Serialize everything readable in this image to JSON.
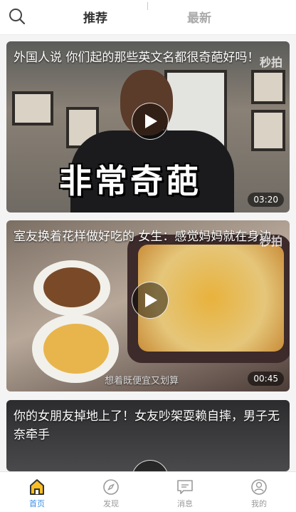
{
  "header": {
    "search_icon": "search-icon",
    "tabs": [
      {
        "label": "推荐",
        "active": true
      },
      {
        "label": "最新",
        "active": false
      }
    ]
  },
  "feed": [
    {
      "title": "外国人说 你们起的那些英文名都很奇葩好吗！",
      "duration": "03:20",
      "overlay_text": "非常奇葩",
      "watermark": "秒拍"
    },
    {
      "title": "室友换着花样做好吃的 女生：感觉妈妈就在身边",
      "duration": "00:45",
      "overlay_text": "想着既便宜又划算",
      "watermark": "秒拍"
    },
    {
      "title": "你的女朋友掉地上了！女友吵架耍赖自摔，男子无奈牵手"
    }
  ],
  "bottom_nav": [
    {
      "label": "首页",
      "icon": "home-icon",
      "active": true
    },
    {
      "label": "发现",
      "icon": "compass-icon",
      "active": false
    },
    {
      "label": "消息",
      "icon": "message-icon",
      "active": false
    },
    {
      "label": "我的",
      "icon": "user-icon",
      "active": false
    }
  ],
  "colors": {
    "accent": "#3a8ee6",
    "inactive": "#9a9a9a"
  }
}
